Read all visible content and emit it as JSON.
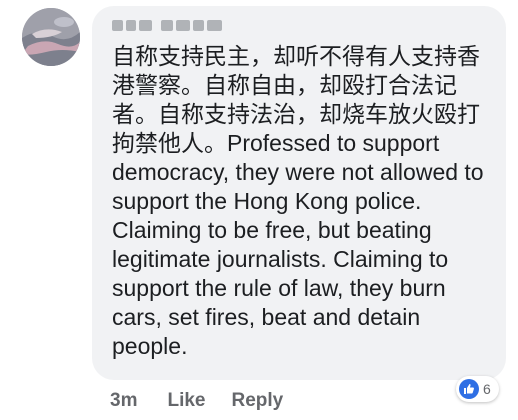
{
  "comment": {
    "author_name": "▒▒▒ ▒▒▒▒▒▒▒",
    "text": "自称支持民主，却听不得有人支持香港警察。自称自由，却殴打合法记者。自称支持法治，却烧车放火殴打拘禁他人。Professed to support democracy, they were not allowed to support the Hong Kong police. Claiming to be free, but beating legitimate journalists. Claiming to support the rule of law, they burn cars, set fires, beat and detain people.",
    "reaction_icon": "thumbs-up-icon",
    "reaction_count": "6",
    "colors": {
      "bubble": "#f1f2f4",
      "text": "#1c1e21",
      "meta": "#65676b",
      "like_badge": "#2f6fe4"
    }
  },
  "footer": {
    "timestamp": "3m",
    "like_label": "Like",
    "reply_label": "Reply"
  }
}
